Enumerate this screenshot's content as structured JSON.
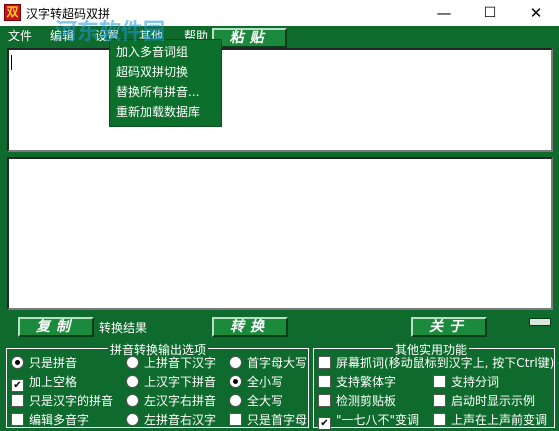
{
  "window": {
    "title": "汉字转超码双拼",
    "app_icon_glyph": "双",
    "minimize_glyph": "—",
    "maximize_glyph": "☐",
    "close_glyph": "✕"
  },
  "watermark": "河东软件园",
  "menu": {
    "items": [
      "文件",
      "编辑",
      "设置",
      "其他",
      "帮助"
    ],
    "dropdown": [
      "加入多音词组",
      "超码双拼切换",
      "替换所有拼音...",
      "重新加载数据库"
    ]
  },
  "buttons": {
    "paste": "粘贴",
    "copy": "复制",
    "convert": "转换",
    "close": "关于",
    "convert_result_label": "转换结果"
  },
  "pinyin_group": {
    "legend": "拼音转换输出选项",
    "col1": [
      {
        "label": "只是拼音",
        "type": "radio",
        "checked": true
      },
      {
        "label": "加上空格",
        "type": "check",
        "checked": true
      },
      {
        "label": "只是汉字的拼音",
        "type": "check",
        "checked": false
      },
      {
        "label": "编辑多音字",
        "type": "check",
        "checked": false
      }
    ],
    "col2": [
      {
        "label": "上拼音下汉字",
        "type": "radio",
        "checked": false
      },
      {
        "label": "上汉字下拼音",
        "type": "radio",
        "checked": false
      },
      {
        "label": "左汉字右拼音",
        "type": "radio",
        "checked": false
      },
      {
        "label": "左拼音右汉字",
        "type": "radio",
        "checked": false
      }
    ],
    "col3": [
      {
        "label": "首字母大写",
        "type": "radio",
        "checked": false
      },
      {
        "label": "全小写",
        "type": "radio",
        "checked": true
      },
      {
        "label": "全大写",
        "type": "radio",
        "checked": false
      },
      {
        "label": "只是首字母",
        "type": "check",
        "checked": false
      }
    ]
  },
  "other_group": {
    "legend": "其他实用功能",
    "items": [
      {
        "label": "屏幕抓词(移动鼠标到汉字上, 按下Ctrl键)",
        "checked": false
      },
      {
        "label": "支持繁体字",
        "checked": false
      },
      {
        "label": "支持分词",
        "checked": false
      },
      {
        "label": "检测剪贴板",
        "checked": false
      },
      {
        "label": "启动时显示示例",
        "checked": false
      },
      {
        "label": "\"一七八不\"变调",
        "checked": true
      },
      {
        "label": "上声在上声前变调",
        "checked": false
      }
    ]
  }
}
